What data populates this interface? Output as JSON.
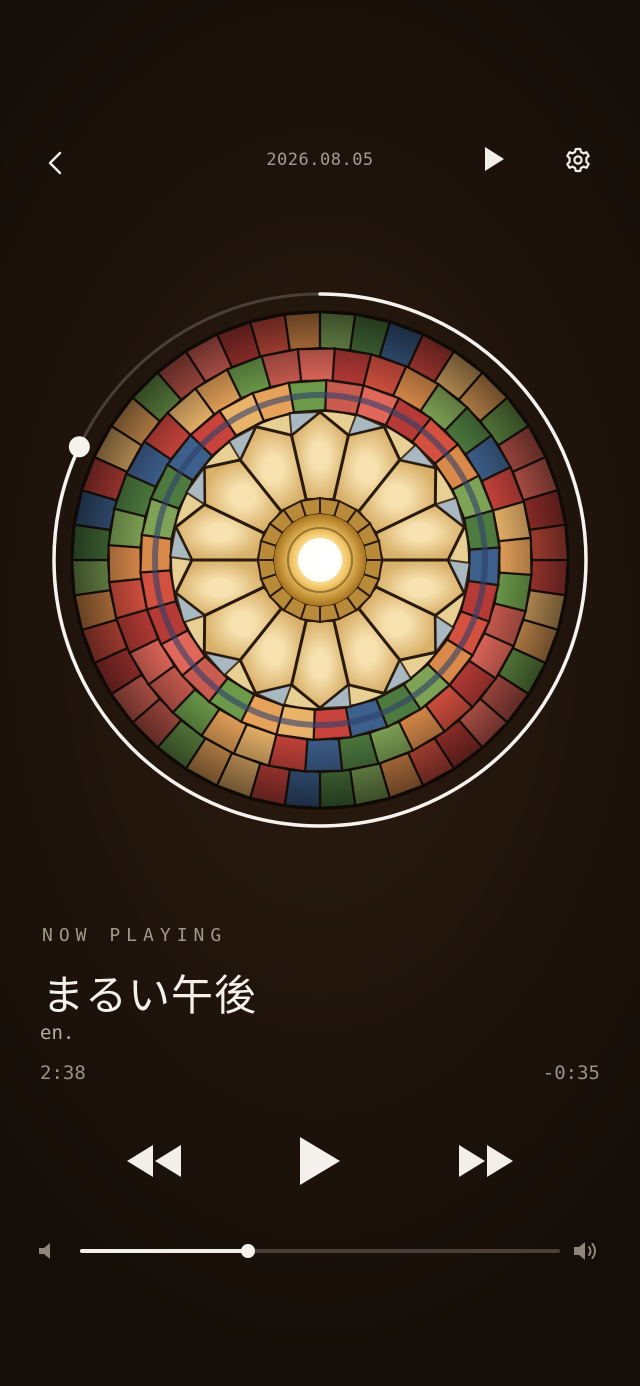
{
  "header": {
    "date": "2026.08.05"
  },
  "player": {
    "section_label": "NOW PLAYING",
    "title": "まるい午後",
    "artist": "en.",
    "elapsed": "2:38",
    "remaining": "-0:35",
    "progress_fraction": 0.82,
    "volume_fraction": 0.35
  },
  "icons": {
    "back": "chevron-left-icon",
    "header_play": "play-icon",
    "settings": "gear-icon",
    "rewind": "rewind-icon",
    "main_play": "play-icon",
    "fast_forward": "fast-forward-icon",
    "volume_low": "volume-low-icon",
    "volume_high": "volume-high-icon"
  },
  "colors": {
    "background": "#1f140c",
    "foreground": "#f2eee8",
    "muted_text": "#a29889"
  }
}
